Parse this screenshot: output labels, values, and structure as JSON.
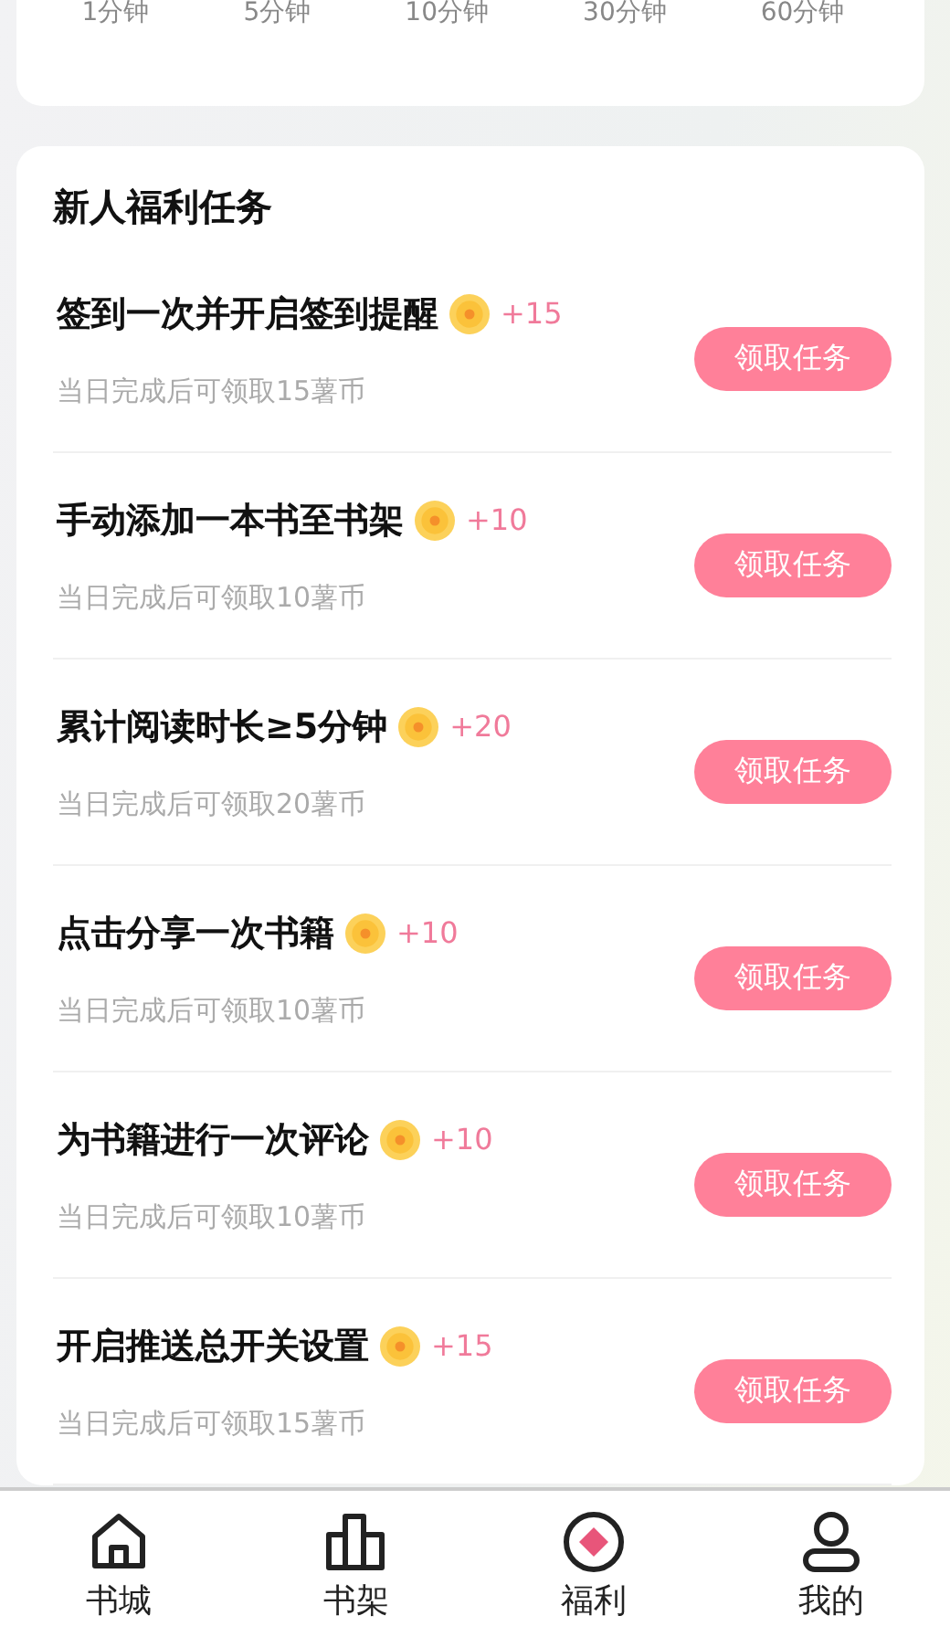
{
  "durations": [
    "1分钟",
    "5分钟",
    "10分钟",
    "30分钟",
    "60分钟"
  ],
  "tasks_section": {
    "title": "新人福利任务",
    "tasks": [
      {
        "title": "签到一次并开启签到提醒",
        "reward": "+15",
        "note": "当日完成后可领取15薯币",
        "button": "领取任务"
      },
      {
        "title": "手动添加一本书至书架",
        "reward": "+10",
        "note": "当日完成后可领取10薯币",
        "button": "领取任务"
      },
      {
        "title": "累计阅读时长≥5分钟",
        "reward": "+20",
        "note": "当日完成后可领取20薯币",
        "button": "领取任务"
      },
      {
        "title": "点击分享一次书籍",
        "reward": "+10",
        "note": "当日完成后可领取10薯币",
        "button": "领取任务"
      },
      {
        "title": "为书籍进行一次评论",
        "reward": "+10",
        "note": "当日完成后可领取10薯币",
        "button": "领取任务"
      },
      {
        "title": "开启推送总开关设置",
        "reward": "+15",
        "note": "当日完成后可领取15薯币",
        "button": "领取任务"
      }
    ]
  },
  "tab_bar": [
    {
      "label": "书城",
      "kind": "home",
      "selected": false
    },
    {
      "label": "书架",
      "kind": "shelf",
      "selected": false
    },
    {
      "label": "福利",
      "kind": "welfare",
      "selected": true
    },
    {
      "label": "我的",
      "kind": "me",
      "selected": false
    }
  ]
}
